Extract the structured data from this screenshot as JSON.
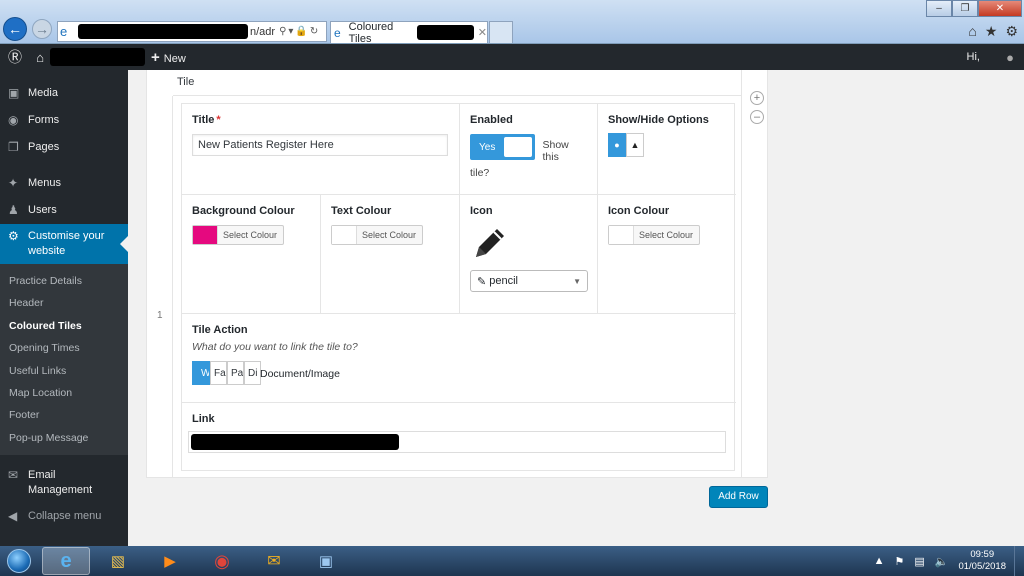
{
  "browser": {
    "url_suffix": "n/adr",
    "tab_title": "Coloured Tiles"
  },
  "adminbar": {
    "new_label": "New",
    "greeting": "Hi,"
  },
  "sidebar": {
    "items": [
      {
        "label": "Media",
        "icon": "media-icon"
      },
      {
        "label": "Forms",
        "icon": "forms-icon"
      },
      {
        "label": "Pages",
        "icon": "pages-icon"
      },
      {
        "label": "Menus",
        "icon": "menus-icon"
      },
      {
        "label": "Users",
        "icon": "users-icon"
      },
      {
        "label": "Customise your website",
        "icon": "gear-icon"
      }
    ],
    "submenu": [
      "Practice Details",
      "Header",
      "Coloured Tiles",
      "Opening Times",
      "Useful Links",
      "Map Location",
      "Footer",
      "Pop-up Message"
    ],
    "bottom": [
      {
        "label": "Email Management",
        "icon": "email-icon"
      },
      {
        "label": "Collapse menu",
        "icon": "collapse-icon"
      }
    ]
  },
  "panel": {
    "header": "Tile",
    "row_number": "1",
    "title_label": "Title",
    "title_required": "*",
    "title_value": "New Patients Register Here",
    "enabled_label": "Enabled",
    "toggle_on": "Yes",
    "toggle_desc_1": "Show this",
    "toggle_desc_2": "tile?",
    "showhide_label": "Show/Hide Options",
    "bg_colour_label": "Background Colour",
    "bg_colour": "#e5097f",
    "text_colour_label": "Text Colour",
    "text_colour": "#ffffff",
    "icon_label": "Icon",
    "icon_value": "pencil",
    "icon_colour_label": "Icon Colour",
    "icon_colour": "#ffffff",
    "select_colour": "Select Colour",
    "tile_action_label": "Tile Action",
    "tile_action_desc": "What do you want to link the tile to?",
    "action_options": [
      "W",
      "Fa",
      "Pa",
      "Di"
    ],
    "action_overflow": "Document/Image",
    "link_label": "Link",
    "add_row": "Add Row"
  },
  "taskbar": {
    "time": "09:59",
    "date": "01/05/2018"
  },
  "colors": {
    "admin_dark": "#23282d",
    "wp_blue": "#0073aa",
    "toggle_blue": "#3498db"
  }
}
